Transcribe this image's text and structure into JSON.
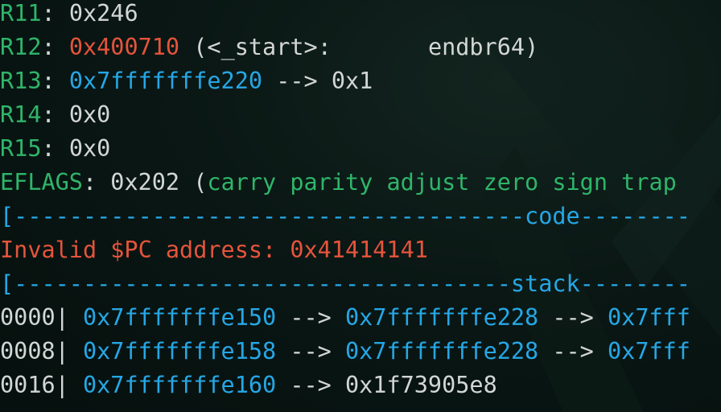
{
  "registers": [
    {
      "name": "R11",
      "sep": ": ",
      "value": "0x246",
      "rest": ""
    },
    {
      "name": "R12",
      "sep": ": ",
      "value": "0x400710",
      "rest_open": " (",
      "rest_green": "",
      "rest": "<_start>:       endbr64)"
    },
    {
      "name": "R13",
      "sep": ": ",
      "value": "0x7fffffffe220",
      "rest": " --> 0x1"
    },
    {
      "name": "R14",
      "sep": ": ",
      "value": "0x0",
      "rest": ""
    },
    {
      "name": "R15",
      "sep": ": ",
      "value": "0x0",
      "rest": ""
    }
  ],
  "eflags": {
    "name": "EFLAGS",
    "sep": ": ",
    "value": "0x202",
    "open": " (",
    "flags": "carry parity adjust zero sign trap"
  },
  "code_header": {
    "left": "[-------------------------------------",
    "label": "code",
    "right": "--------"
  },
  "error": {
    "label": "Invalid $PC address: ",
    "value": "0x41414141"
  },
  "stack_header": {
    "left": "[------------------------------------",
    "label": "stack",
    "right": "--------"
  },
  "stack": [
    {
      "offset": "0000",
      "bar": "| ",
      "addr": "0x7fffffffe150",
      "arrow1": " --> ",
      "target": "0x7fffffffe228",
      "arrow2": " --> ",
      "target2": "0x7fff"
    },
    {
      "offset": "0008",
      "bar": "| ",
      "addr": "0x7fffffffe158",
      "arrow1": " --> ",
      "target": "0x7fffffffe228",
      "arrow2": " --> ",
      "target2": "0x7fff"
    },
    {
      "offset": "0016",
      "bar": "| ",
      "addr": "0x7fffffffe160",
      "arrow1": " --> ",
      "target": "0x1f73905e8",
      "arrow2": "",
      "target2": ""
    }
  ]
}
